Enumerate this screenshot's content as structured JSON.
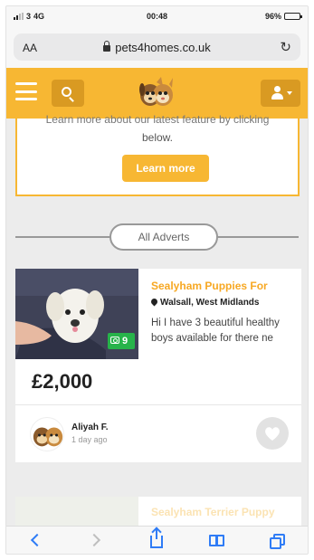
{
  "status": {
    "carrier": "3",
    "network": "4G",
    "time": "00:48",
    "battery": "96%"
  },
  "browser": {
    "text_size": "AA",
    "url": "pets4homes.co.uk"
  },
  "promo": {
    "cut_text": "Learn more about our latest feature by clicking",
    "below": "below.",
    "button": "Learn more"
  },
  "section": {
    "label": "All Adverts"
  },
  "advert": {
    "title": "Sealyham Puppies For",
    "location": "Walsall, West Midlands",
    "description": "Hi I have 3 beautiful healthy boys available for there ne",
    "photo_count": "9",
    "price": "£2,000",
    "seller_name": "Aliyah F.",
    "posted": "1 day ago"
  },
  "advert2": {
    "title": "Sealyham Terrier Puppy"
  },
  "colors": {
    "brand": "#f7b733",
    "title": "#f7a823",
    "photo_badge": "#27b34a",
    "ios_blue": "#2f7cf6"
  }
}
